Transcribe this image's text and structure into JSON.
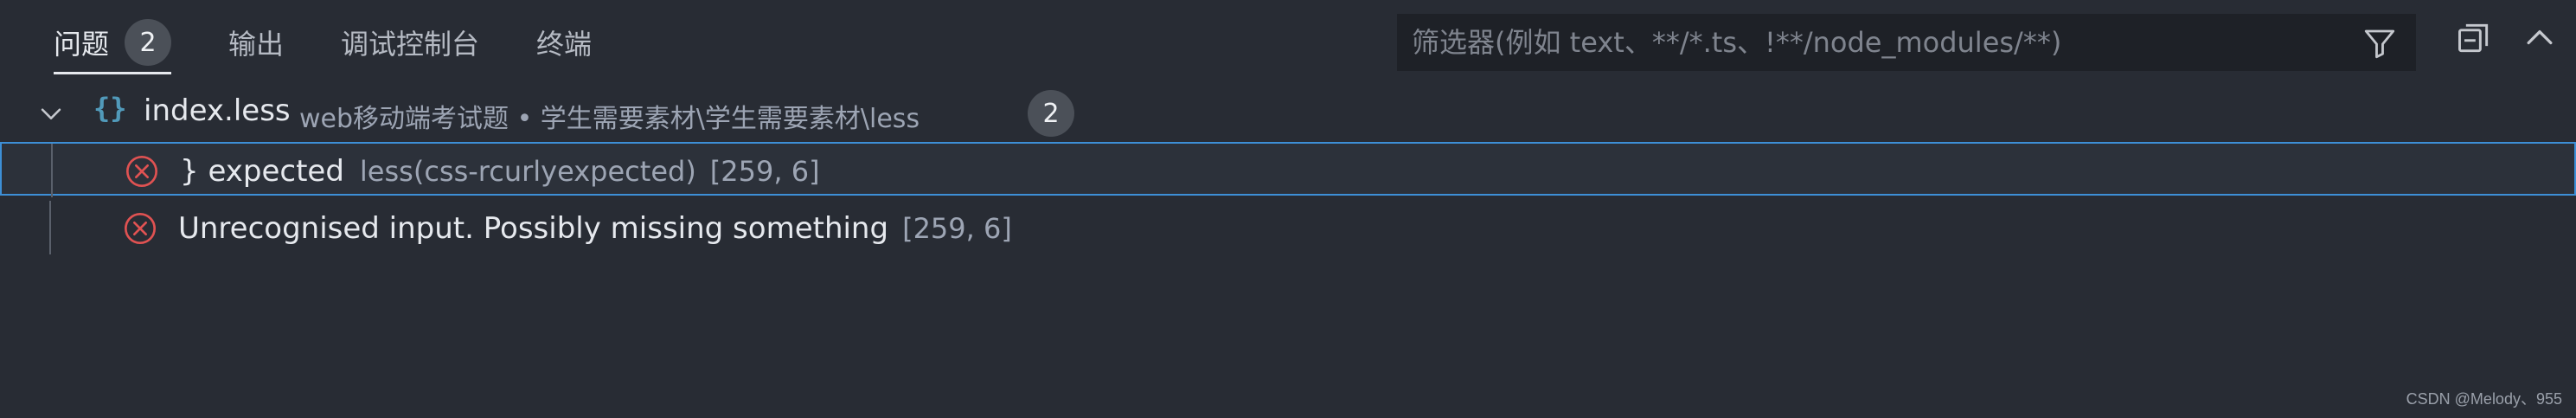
{
  "tabs": [
    {
      "label": "问题",
      "count": "2",
      "active": true
    },
    {
      "label": "输出"
    },
    {
      "label": "调试控制台"
    },
    {
      "label": "终端"
    }
  ],
  "filter": {
    "placeholder": "筛选器(例如 text、**/*.ts、!**/node_modules/**)",
    "value": "",
    "icon": "filter-icon"
  },
  "toolbar": {
    "collapse_icon": "collapse-all-icon",
    "chevron_icon": "chevron-up-icon"
  },
  "file": {
    "icon": "{}",
    "name": "index.less",
    "path": "web移动端考试题 • 学生需要素材\\学生需要素材\\less",
    "count": "2"
  },
  "problems": [
    {
      "message": "} expected",
      "source": "less(css-rcurlyexpected)",
      "location": "[259, 6]",
      "selected": true
    },
    {
      "message": "Unrecognised input. Possibly missing something",
      "source": "",
      "location": "[259, 6]",
      "selected": false
    }
  ],
  "colors": {
    "background": "#282c34",
    "error": "#e05252",
    "selection_border": "#3d8fd6",
    "file_icon": "#519aba"
  },
  "watermark": "CSDN @Melody、955"
}
